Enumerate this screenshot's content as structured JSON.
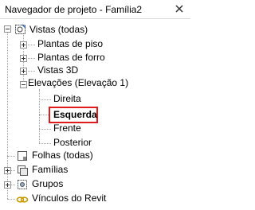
{
  "title": "Navegador de projeto - Família2",
  "tree": {
    "vistas": "Vistas (todas)",
    "plantas_piso": "Plantas de piso",
    "plantas_forro": "Plantas de forro",
    "vistas_3d": "Vistas 3D",
    "elevacoes": "Elevações (Elevação 1)",
    "direita": "Direita",
    "esquerda": "Esquerda",
    "frente": "Frente",
    "posterior": "Posterior",
    "folhas": "Folhas (todas)",
    "familias": "Famílias",
    "grupos": "Grupos",
    "vinculos": "Vínculos do Revit"
  },
  "colors": {
    "highlight_border": "#e11b1b"
  }
}
